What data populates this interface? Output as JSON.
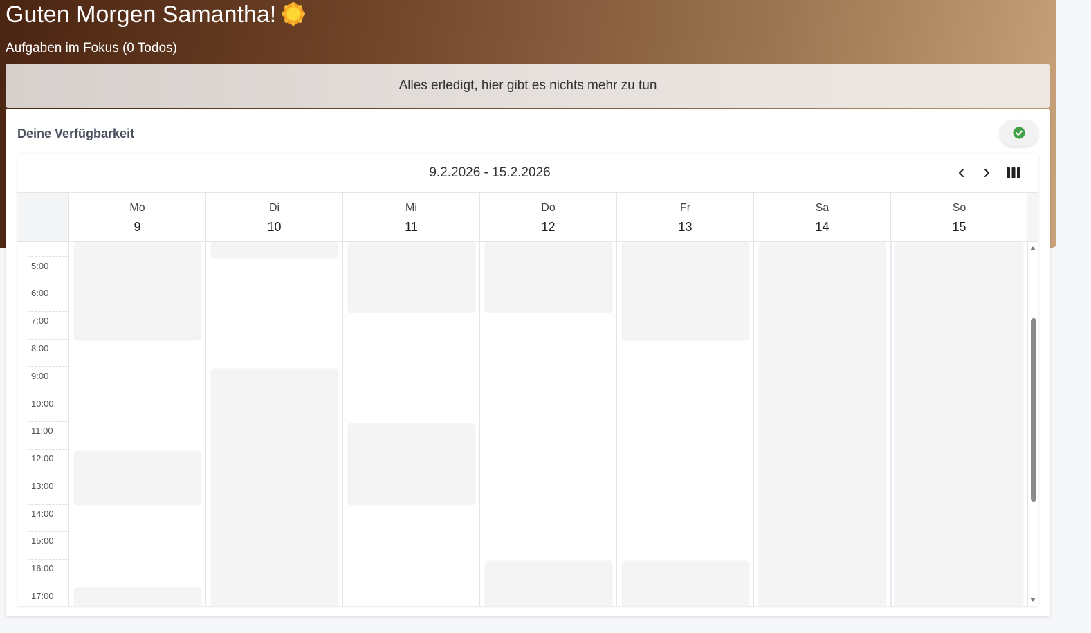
{
  "header": {
    "greeting": "Guten Morgen Samantha!",
    "greeting_icon": "sun-icon",
    "focus_title": "Aufgaben im Fokus (0 Todos)"
  },
  "focus": {
    "empty_message": "Alles erledigt, hier gibt es nichts mehr zu tun"
  },
  "availability": {
    "title": "Deine Verfügbarkeit",
    "status_icon": "check-circle-icon",
    "status_color": "#43a047"
  },
  "calendar": {
    "date_range": "9.2.2026 - 15.2.2026",
    "prev_icon": "chevron-left-icon",
    "next_icon": "chevron-right-icon",
    "view_icon": "week-view-icon",
    "days": [
      {
        "name": "Mo",
        "num": "9"
      },
      {
        "name": "Di",
        "num": "10"
      },
      {
        "name": "Mi",
        "num": "11"
      },
      {
        "name": "Do",
        "num": "12"
      },
      {
        "name": "Fr",
        "num": "13"
      },
      {
        "name": "Sa",
        "num": "14"
      },
      {
        "name": "So",
        "num": "15"
      }
    ],
    "times": [
      "5:00",
      "6:00",
      "7:00",
      "8:00",
      "9:00",
      "10:00",
      "11:00",
      "12:00",
      "13:00",
      "14:00",
      "15:00",
      "16:00",
      "17:00"
    ]
  }
}
